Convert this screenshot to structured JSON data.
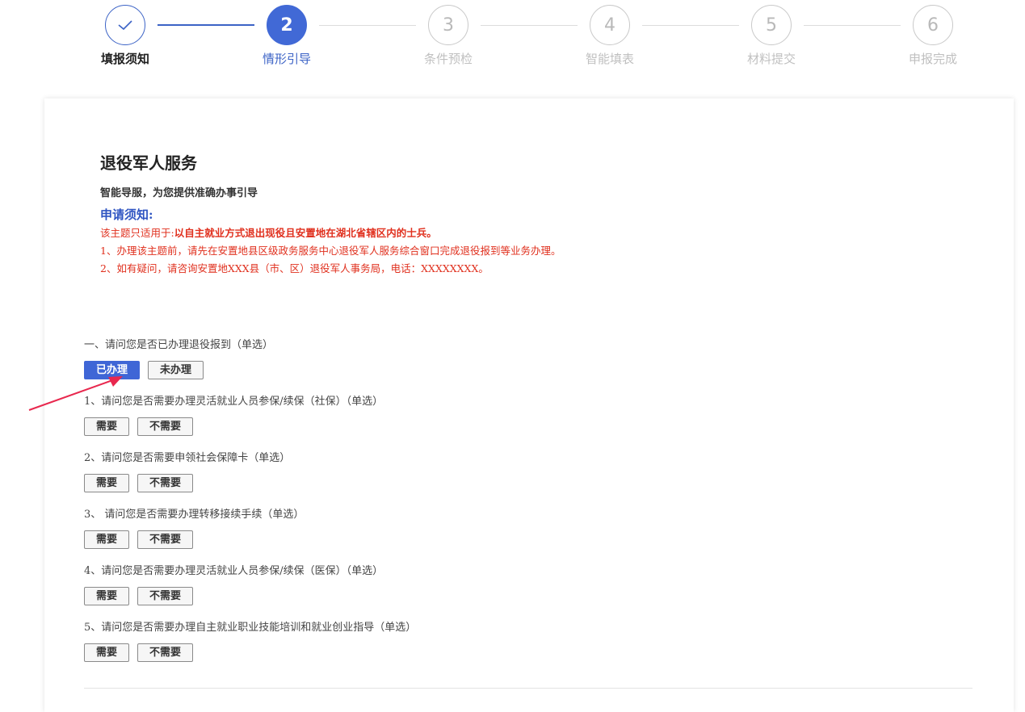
{
  "stepper": {
    "steps": [
      {
        "number": "",
        "label": "填报须知",
        "state": "done"
      },
      {
        "number": "2",
        "label": "情形引导",
        "state": "active"
      },
      {
        "number": "3",
        "label": "条件预检",
        "state": "pending"
      },
      {
        "number": "4",
        "label": "智能填表",
        "state": "pending"
      },
      {
        "number": "5",
        "label": "材料提交",
        "state": "pending"
      },
      {
        "number": "6",
        "label": "申报完成",
        "state": "pending"
      }
    ],
    "done_icon": "check-icon"
  },
  "service": {
    "title": "退役军人服务",
    "subtitle": "智能导服，为您提供准确办事引导"
  },
  "notice": {
    "heading": "申请须知:",
    "scope_prefix": "该主题只适用于:",
    "scope_strong": "以自主就业方式退出现役且安置地在湖北省辖区内的士兵。",
    "line1": "1、办理该主题前，请先在安置地县区级政务服务中心退役军人服务综合窗口完成退役报到等业务办理。",
    "line2": "2、如有疑问，请咨询安置地XXX县（市、区）退役军人事务局，电话：XXXXXXXX。"
  },
  "questions": [
    {
      "text": "一、请问您是否已办理退役报到（单选）",
      "options": [
        "已办理",
        "未办理"
      ],
      "selected": 0
    },
    {
      "text": "1、请问您是否需要办理灵活就业人员参保/续保（社保）（单选）",
      "options": [
        "需要",
        "不需要"
      ],
      "selected": -1
    },
    {
      "text": "2、请问您是否需要申领社会保障卡（单选）",
      "options": [
        "需要",
        "不需要"
      ],
      "selected": -1
    },
    {
      "text": "3、 请问您是否需要办理转移接续手续（单选）",
      "options": [
        "需要",
        "不需要"
      ],
      "selected": -1
    },
    {
      "text": "4、请问您是否需要办理灵活就业人员参保/续保（医保）（单选）",
      "options": [
        "需要",
        "不需要"
      ],
      "selected": -1
    },
    {
      "text": "5、请问您是否需要办理自主就业职业技能培训和就业创业指导（单选）",
      "options": [
        "需要",
        "不需要"
      ],
      "selected": -1
    }
  ],
  "colors": {
    "primary": "#3f66d6",
    "notice_red": "#e0301e",
    "annotation_arrow": "#e8284e"
  }
}
